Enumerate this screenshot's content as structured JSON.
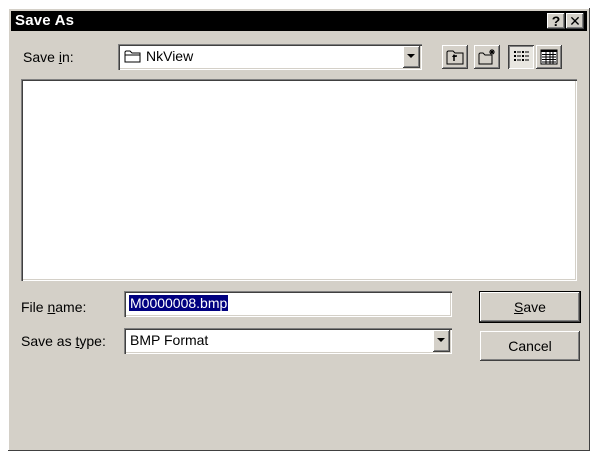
{
  "window": {
    "title": "Save As",
    "help_button": "?",
    "close_button": "✕"
  },
  "save_in": {
    "label_pre": "Save ",
    "label_accel": "i",
    "label_post": "n:",
    "value": "NkView",
    "icon": "folder-icon"
  },
  "toolbar": {
    "buttons": [
      "up-one-level-icon",
      "create-new-folder-icon",
      "list-view-icon",
      "details-view-icon"
    ]
  },
  "file_name": {
    "label_pre": "File ",
    "label_accel": "n",
    "label_post": "ame:",
    "value": "M0000008.bmp"
  },
  "save_as_type": {
    "label_pre": "Save as ",
    "label_accel": "t",
    "label_post": "ype:",
    "value": "BMP Format"
  },
  "buttons": {
    "save_accel": "S",
    "save_rest": "ave",
    "cancel": "Cancel"
  }
}
